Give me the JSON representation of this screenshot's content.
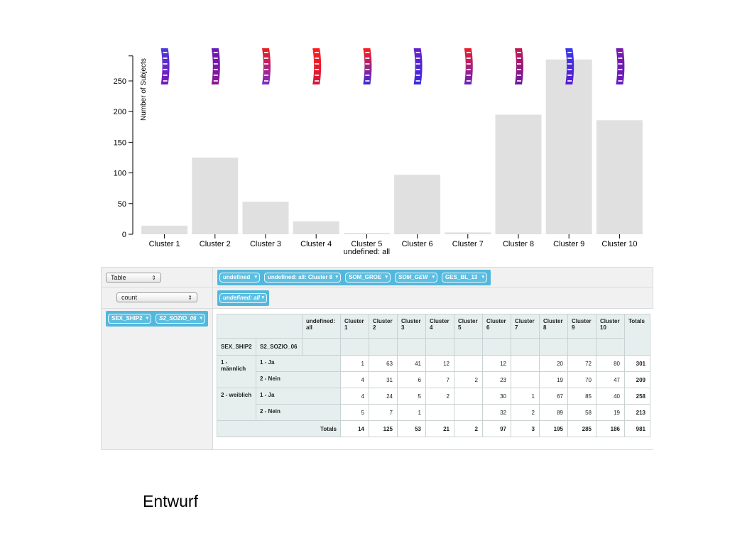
{
  "chart_data": {
    "type": "bar",
    "categories": [
      "Cluster 1",
      "Cluster 2",
      "Cluster 3",
      "Cluster 4",
      "Cluster 5",
      "Cluster 6",
      "Cluster 7",
      "Cluster 8",
      "Cluster 9",
      "Cluster 10"
    ],
    "category_sublabels": [
      "",
      "",
      "",
      "",
      "undefined: all",
      "",
      "",
      "",
      "",
      ""
    ],
    "values": [
      14,
      125,
      53,
      21,
      2,
      97,
      3,
      195,
      285,
      186
    ],
    "ylabel": "Number of Subjects",
    "xlabel": "",
    "yticks": [
      0,
      50,
      100,
      150,
      200,
      250
    ],
    "ylim": [
      0,
      285
    ],
    "bar_color": "#e0e0e0",
    "thumbnail_colors": [
      [
        "#4a3ad8",
        "#7a18b8"
      ],
      [
        "#6a18b8",
        "#8a1890"
      ],
      [
        "#ee1c1c",
        "#7a2ad0"
      ],
      [
        "#ff1c1c",
        "#d01a40"
      ],
      [
        "#ff1c1c",
        "#3a2ae0"
      ],
      [
        "#6a20c8",
        "#3a2ae0"
      ],
      [
        "#ee1c2c",
        "#6a20c0"
      ],
      [
        "#c21850",
        "#6a1aa0"
      ],
      [
        "#3a3ae8",
        "#5a1ad0"
      ],
      [
        "#7a1aa8",
        "#6a18c0"
      ]
    ]
  },
  "pivot": {
    "renderer_select": "Table",
    "aggregator_select": "count",
    "col_attrs": [
      "undefined",
      "undefined: all: Cluster 8",
      "SOM_GROE",
      "SOM_GEW",
      "GES_BL_13"
    ],
    "val_attrs": [
      "undefined: all"
    ],
    "row_attrs": [
      "SEX_SHIP2",
      "S2_SOZIO_06"
    ],
    "table": {
      "corner_label": "undefined: all",
      "columns": [
        "Cluster 1",
        "Cluster 2",
        "Cluster 3",
        "Cluster 4",
        "Cluster 5",
        "Cluster 6",
        "Cluster 7",
        "Cluster 8",
        "Cluster 9",
        "Cluster 10"
      ],
      "totals_label": "Totals",
      "row_headers": [
        "SEX_SHIP2",
        "S2_SOZIO_06"
      ],
      "groups": [
        {
          "label": "1 - männlich",
          "rows": [
            {
              "label": "1 - Ja",
              "values": [
                "1",
                "63",
                "41",
                "12",
                "",
                "12",
                "",
                "20",
                "72",
                "80"
              ],
              "total": "301"
            },
            {
              "label": "2 - Nein",
              "values": [
                "4",
                "31",
                "6",
                "7",
                "2",
                "23",
                "",
                "19",
                "70",
                "47"
              ],
              "total": "209"
            }
          ]
        },
        {
          "label": "2 - weiblich",
          "rows": [
            {
              "label": "1 - Ja",
              "values": [
                "4",
                "24",
                "5",
                "2",
                "",
                "30",
                "1",
                "67",
                "85",
                "40"
              ],
              "total": "258"
            },
            {
              "label": "2 - Nein",
              "values": [
                "5",
                "7",
                "1",
                "",
                "",
                "32",
                "2",
                "89",
                "58",
                "19"
              ],
              "total": "213"
            }
          ]
        }
      ],
      "column_totals": [
        "14",
        "125",
        "53",
        "21",
        "2",
        "97",
        "3",
        "195",
        "285",
        "186"
      ],
      "grand_total": "981"
    }
  },
  "footer_text": "Entwurf"
}
